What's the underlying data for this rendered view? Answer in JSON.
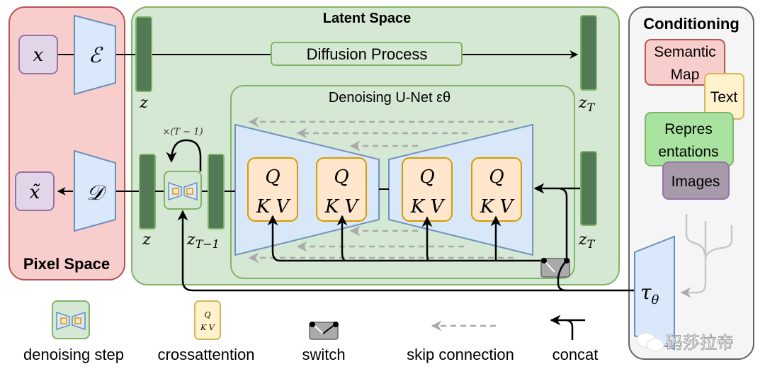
{
  "regions": {
    "pixel_space": "Pixel Space",
    "latent_space": "Latent Space",
    "conditioning": "Conditioning",
    "unet": "Denoising U-Net εθ"
  },
  "pixel": {
    "input": "x",
    "output": "x̃",
    "encoder": "ℰ",
    "decoder": "𝒟"
  },
  "latent": {
    "diffusion_process": "Diffusion Process",
    "z_top": "z",
    "z_bottom": "z",
    "z_t_top": "z",
    "z_t_top_sub": "T",
    "z_t_mid": "z",
    "z_t_mid_sub": "T",
    "z_t_minus_1": "z",
    "z_t_minus_1_sub": "T−1",
    "repeat": "×(T − 1)"
  },
  "attention": {
    "q": "Q",
    "kv": "K V",
    "blocks": 4
  },
  "conditioning": {
    "items": [
      {
        "label": "Semantic Map",
        "color": "#f8cecc",
        "stroke": "#b85450"
      },
      {
        "label": "Text",
        "color": "#fff2cc",
        "stroke": "#d6b656"
      },
      {
        "label": "Repres entations",
        "color": "#a9e3a0",
        "stroke": "#82b366"
      },
      {
        "label": "Images",
        "color": "#a89aab",
        "stroke": "#9673a6"
      }
    ],
    "encoder": "τ",
    "encoder_sub": "θ",
    "watermark": "码莎拉帝"
  },
  "legend": {
    "items": [
      {
        "label": "denoising step"
      },
      {
        "label": "crossattention"
      },
      {
        "label": "switch"
      },
      {
        "label": "skip connection"
      },
      {
        "label": "concat"
      }
    ]
  },
  "colors": {
    "pixel_bg": "#f8cecc",
    "pixel_stroke": "#b85450",
    "latent_bg": "#d5e8d4",
    "latent_stroke": "#82b366",
    "latent_bar": "#527a55",
    "encoder_fill": "#dae8fc",
    "encoder_stroke": "#6c8ebf",
    "qkv_fill": "#ffe6cc",
    "qkv_stroke": "#d79b00",
    "cond_bg": "#f5f5f5",
    "cond_stroke": "#666666",
    "io_fill": "#e1d5e7",
    "io_stroke": "#9673a6"
  }
}
